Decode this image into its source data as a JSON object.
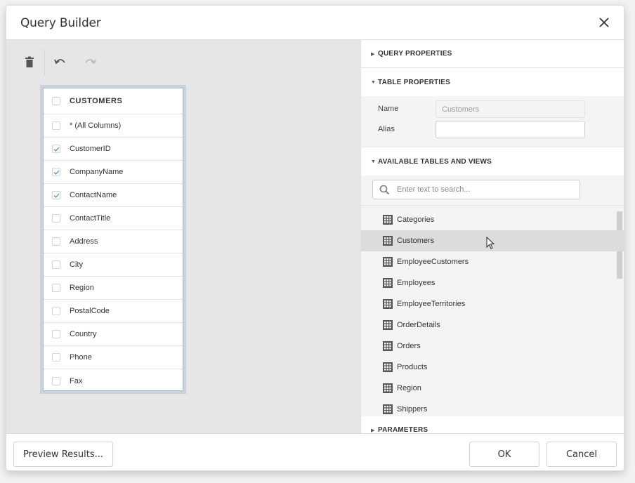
{
  "dialog": {
    "title": "Query Builder",
    "close_icon": "close-icon"
  },
  "toolbar": {
    "delete_icon": "trash-icon",
    "undo_icon": "undo-icon",
    "redo_icon": "redo-icon",
    "redo_enabled": false
  },
  "table_card": {
    "header": {
      "label": "CUSTOMERS",
      "checked": false
    },
    "columns": [
      {
        "label": "* (All Columns)",
        "checked": false
      },
      {
        "label": "CustomerID",
        "checked": true
      },
      {
        "label": "CompanyName",
        "checked": true
      },
      {
        "label": "ContactName",
        "checked": true
      },
      {
        "label": "ContactTitle",
        "checked": false
      },
      {
        "label": "Address",
        "checked": false
      },
      {
        "label": "City",
        "checked": false
      },
      {
        "label": "Region",
        "checked": false
      },
      {
        "label": "PostalCode",
        "checked": false
      },
      {
        "label": "Country",
        "checked": false
      },
      {
        "label": "Phone",
        "checked": false
      },
      {
        "label": "Fax",
        "checked": false
      }
    ]
  },
  "properties": {
    "query_properties": {
      "label": "QUERY PROPERTIES",
      "expanded": false
    },
    "table_properties": {
      "label": "TABLE PROPERTIES",
      "expanded": true,
      "name_label": "Name",
      "name_value": "Customers",
      "alias_label": "Alias",
      "alias_value": ""
    },
    "available_tables": {
      "label": "AVAILABLE TABLES AND VIEWS",
      "expanded": true,
      "search_placeholder": "Enter text to search...",
      "items": [
        {
          "label": "Categories"
        },
        {
          "label": "Customers",
          "hovered": true
        },
        {
          "label": "EmployeeCustomers"
        },
        {
          "label": "Employees"
        },
        {
          "label": "EmployeeTerritories"
        },
        {
          "label": "OrderDetails"
        },
        {
          "label": "Orders"
        },
        {
          "label": "Products"
        },
        {
          "label": "Region"
        },
        {
          "label": "Shippers"
        }
      ]
    },
    "parameters": {
      "label": "PARAMETERS",
      "expanded": false
    }
  },
  "footer": {
    "preview_label": "Preview Results...",
    "ok_label": "OK",
    "cancel_label": "Cancel"
  }
}
